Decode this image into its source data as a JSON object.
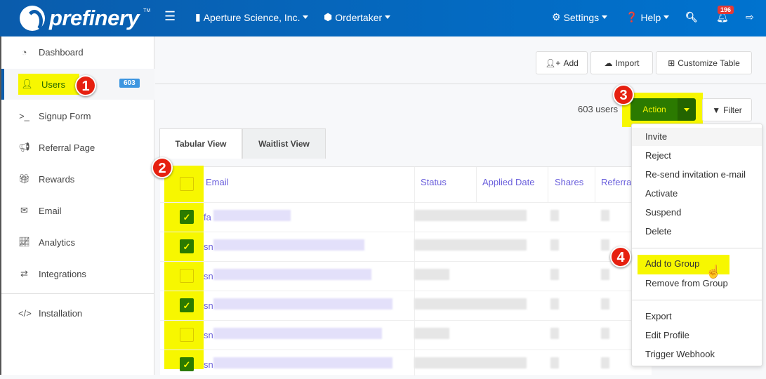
{
  "header": {
    "brand": "prefinery",
    "tm": "TM",
    "org": "Aperture Science, Inc.",
    "project": "Ordertaker",
    "settings": "Settings",
    "help": "Help",
    "notifications": "196"
  },
  "sidebar": {
    "items": [
      {
        "label": "Dashboard"
      },
      {
        "label": "Users",
        "count": "603"
      },
      {
        "label": "Signup Form"
      },
      {
        "label": "Referral Page"
      },
      {
        "label": "Rewards"
      },
      {
        "label": "Email"
      },
      {
        "label": "Analytics"
      },
      {
        "label": "Integrations"
      },
      {
        "label": "Installation"
      }
    ]
  },
  "toolbar": {
    "add": "Add",
    "import": "Import",
    "customize": "Customize Table",
    "count": "603 users",
    "action": "Action",
    "filter": "Filter"
  },
  "tabs": [
    "Tabular View",
    "Waitlist View"
  ],
  "table": {
    "headers": [
      "Email",
      "Status",
      "Applied Date",
      "Shares",
      "Referra"
    ],
    "rows": [
      {
        "email": "fa",
        "checked": true
      },
      {
        "email": "sn",
        "checked": true
      },
      {
        "email": "sn",
        "checked": false
      },
      {
        "email": "sn",
        "checked": true
      },
      {
        "email": "sn",
        "checked": false
      },
      {
        "email": "sn",
        "checked": true
      }
    ]
  },
  "menu": {
    "items": [
      "Invite",
      "Reject",
      "Re-send invitation e-mail",
      "Activate",
      "Suspend",
      "Delete",
      "Add to Group",
      "Remove from Group",
      "Export",
      "Edit Profile",
      "Trigger Webhook"
    ]
  },
  "steps": [
    "1",
    "2",
    "3",
    "4"
  ]
}
